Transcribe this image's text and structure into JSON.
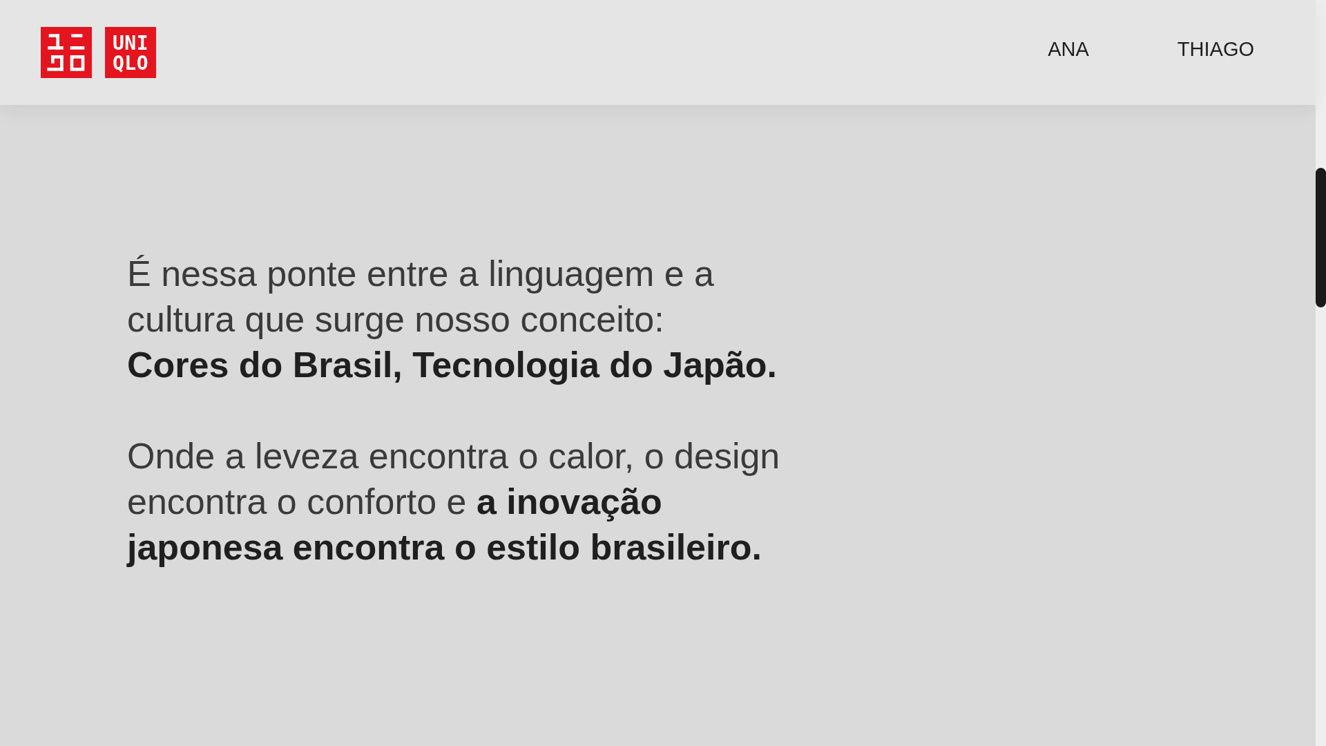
{
  "header": {
    "logo": {
      "lines": [
        "UNI",
        "QLO"
      ]
    },
    "nav": [
      {
        "label": "ANA"
      },
      {
        "label": "THIAGO"
      }
    ]
  },
  "content": {
    "paragraphs": [
      "É nessa ponte entre a linguagem e a cultura que surge nosso conceito:\n**Cores do Brasil, Tecnologia do Japão.**",
      "Onde a leveza encontra o calor, o design encontra o conforto e **a inovação japonesa encontra o estilo brasileiro.**"
    ]
  }
}
